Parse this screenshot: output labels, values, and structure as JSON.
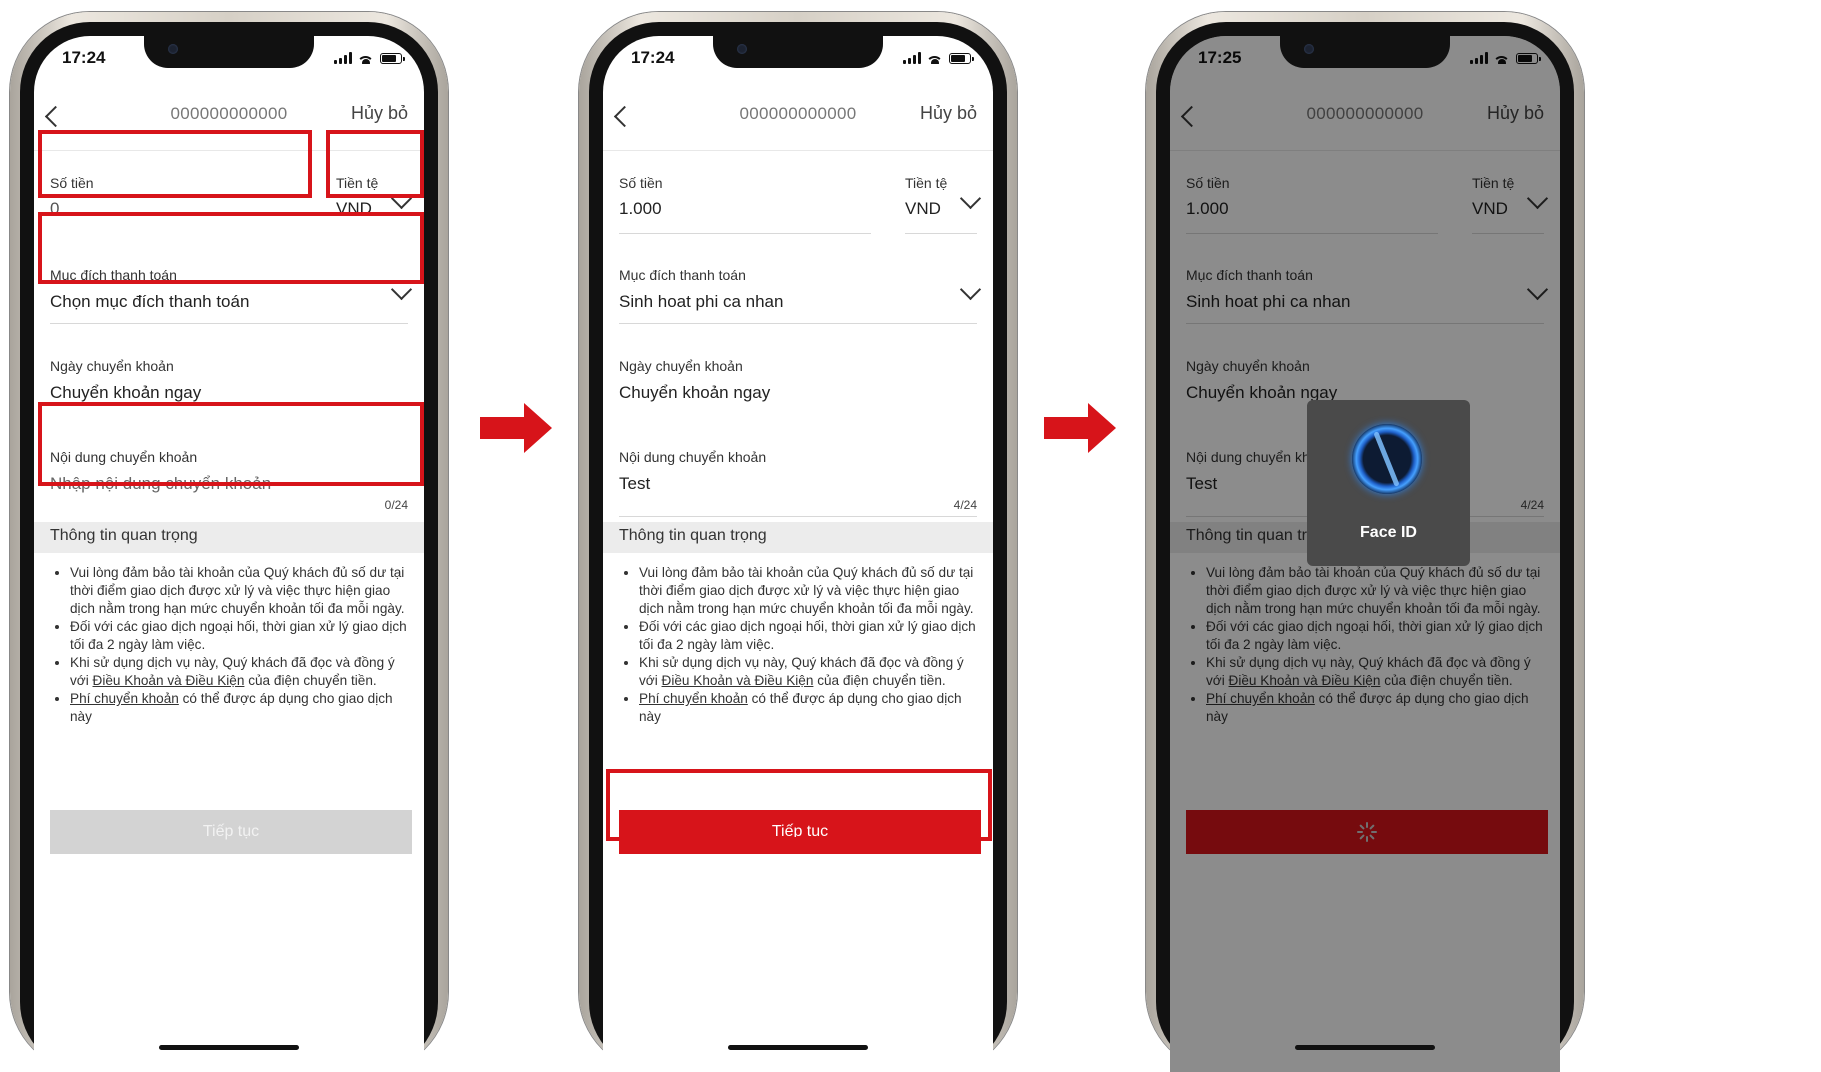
{
  "colors": {
    "accent_red": "#d7141a",
    "disabled_gray": "#d3d3d3"
  },
  "screens": [
    {
      "time": "17:24",
      "account": "000000000000",
      "cancel": "Hủy bỏ",
      "amount_label": "Số tiền",
      "amount_value": "0",
      "currency_label": "Tiền tệ",
      "currency_value": "VND",
      "purpose_label": "Mục đích thanh toán",
      "purpose_value": "Chọn mục đích thanh toán",
      "date_label": "Ngày chuyển khoản",
      "date_value": "Chuyển khoản ngay",
      "content_label": "Nội dung chuyển khoản",
      "content_value": "Nhập nội dung chuyển khoản",
      "counter": "0/24",
      "section_title": "Thông tin quan trọng",
      "continue_label": "Tiếp tục",
      "continue_state": "disabled"
    },
    {
      "time": "17:24",
      "account": "000000000000",
      "cancel": "Hủy bỏ",
      "amount_label": "Số tiền",
      "amount_value": "1.000",
      "currency_label": "Tiền tệ",
      "currency_value": "VND",
      "purpose_label": "Mục đích thanh toán",
      "purpose_value": "Sinh hoat phi ca nhan",
      "date_label": "Ngày chuyển khoản",
      "date_value": "Chuyển khoản ngay",
      "content_label": "Nội dung chuyển khoản",
      "content_value": "Test",
      "counter": "4/24",
      "section_title": "Thông tin quan trọng",
      "continue_label": "Tiếp tục",
      "continue_state": "enabled"
    },
    {
      "time": "17:25",
      "account": "000000000000",
      "cancel": "Hủy bỏ",
      "amount_label": "Số tiền",
      "amount_value": "1.000",
      "currency_label": "Tiền tệ",
      "currency_value": "VND",
      "purpose_label": "Mục đích thanh toán",
      "purpose_value": "Sinh hoat phi ca nhan",
      "date_label": "Ngày chuyển khoản",
      "date_value": "Chuyển khoản ngay",
      "content_label": "Nội dung chuyển khoản",
      "content_value": "Test",
      "counter": "4/24",
      "section_title": "Thông tin quan trọng",
      "continue_state": "loading",
      "faceid_label": "Face ID"
    }
  ],
  "notes": {
    "item1": "Vui lòng đảm bảo tài khoản của Quý khách đủ số dư tại thời điểm giao dịch được xử lý và việc thực hiện giao dịch nằm trong hạn mức chuyển khoản tối đa mỗi ngày.",
    "item2": "Đối với các giao dịch ngoại hối, thời gian xử lý giao dịch tối đa 2 ngày làm việc.",
    "item3_before": "Khi sử dụng dịch vụ này, Quý khách đã đọc và đồng ý với ",
    "item3_link": "Điều Khoản và Điều Kiện",
    "item3_after": " của điện chuyển tiền.",
    "item4_link": "Phí chuyển khoản",
    "item4_after": " có thể được áp dụng cho giao dịch này"
  }
}
